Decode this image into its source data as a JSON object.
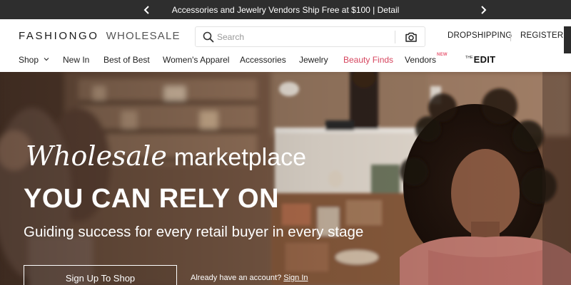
{
  "promo": {
    "text": "Accessories and Jewelry Vendors Ship Free at $100 | Detail",
    "prev_icon": "chevron-left-icon",
    "next_icon": "chevron-right-icon"
  },
  "header": {
    "logo_brand": "FASHIONGO",
    "logo_sub": "WHOLESALE",
    "search_placeholder": "Search",
    "search_value": "",
    "search_icon": "search-icon",
    "camera_icon": "camera-search-icon",
    "links": {
      "dropshipping": "DROPSHIPPING",
      "register": "REGISTER"
    }
  },
  "nav": {
    "items": [
      {
        "label": "Shop"
      },
      {
        "label": "New In"
      },
      {
        "label": "Best of Best"
      },
      {
        "label": "Women's Apparel"
      },
      {
        "label": "Accessories"
      },
      {
        "label": "Jewelry"
      },
      {
        "label": "Beauty Finds",
        "color": "#d6455e"
      },
      {
        "label": "Vendors",
        "badge": "NEW"
      }
    ],
    "edit_the": "THE",
    "edit_label": "EDIT"
  },
  "hero": {
    "line1_script": "Wholesale",
    "line1_plain": "marketplace",
    "line2": "YOU CAN RELY ON",
    "line3": "Guiding success for every retail buyer in every stage",
    "cta": "Sign Up To Shop",
    "account_prompt": "Already have an account?",
    "signin": "Sign In"
  },
  "colors": {
    "promo_bg": "#2e2e2e",
    "accent_pink": "#d6455e",
    "badge_pink": "#e85a73"
  }
}
